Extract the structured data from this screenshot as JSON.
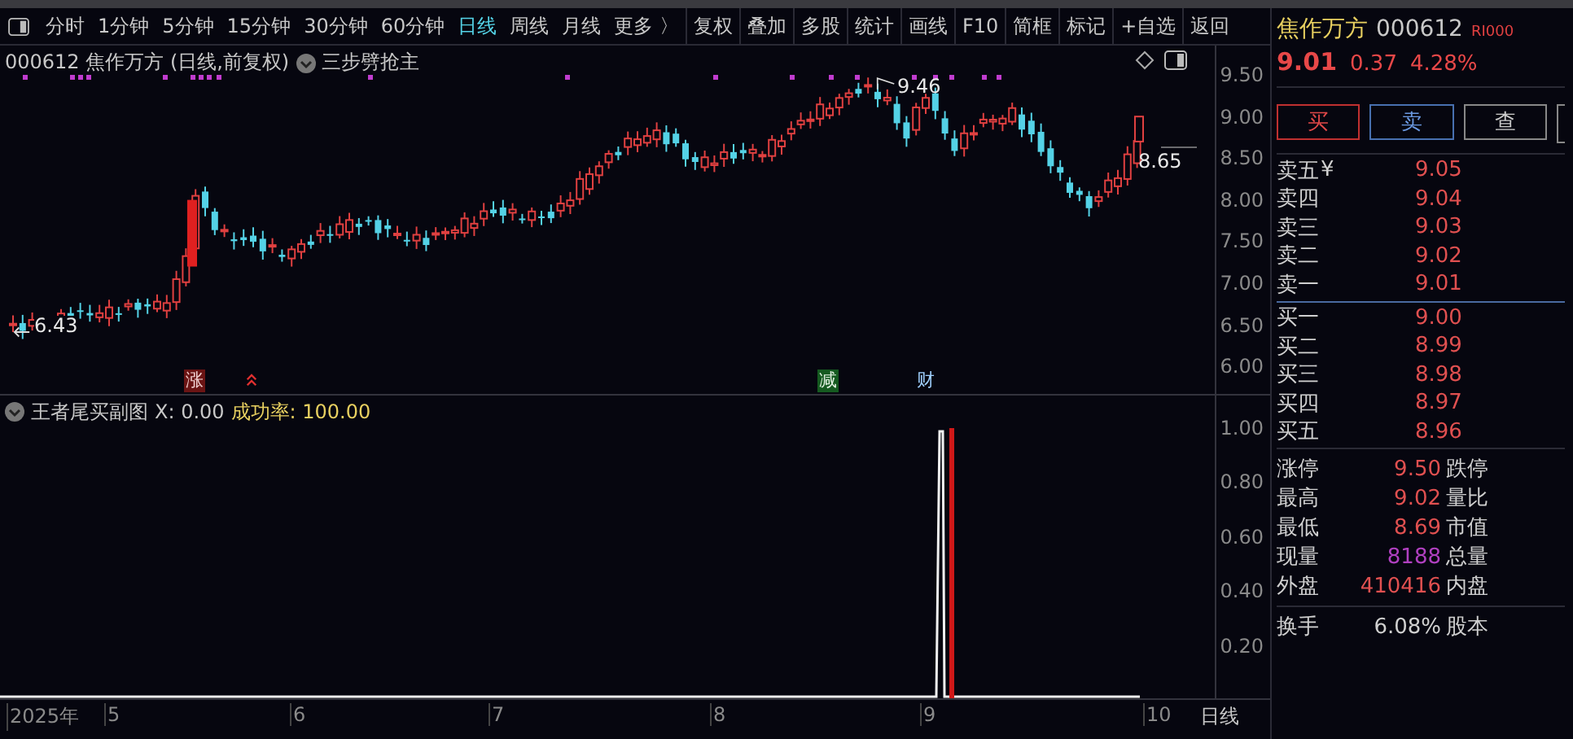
{
  "toolbar": {
    "periods": [
      {
        "label": "分时",
        "selected": false
      },
      {
        "label": "1分钟",
        "selected": false
      },
      {
        "label": "5分钟",
        "selected": false
      },
      {
        "label": "15分钟",
        "selected": false
      },
      {
        "label": "30分钟",
        "selected": false
      },
      {
        "label": "60分钟",
        "selected": false
      },
      {
        "label": "日线",
        "selected": true
      },
      {
        "label": "周线",
        "selected": false
      },
      {
        "label": "月线",
        "selected": false
      },
      {
        "label": "更多 〉",
        "selected": false
      }
    ],
    "tools": [
      "复权",
      "叠加",
      "多股",
      "统计",
      "画线",
      "F10",
      "简框",
      "标记",
      "+自选",
      "返回"
    ]
  },
  "main_chart": {
    "title": "000612 焦作万方 (日线,前复权)",
    "indicator": "三步劈抢主",
    "y_ticks": [
      "9.50",
      "9.00",
      "8.50",
      "8.00",
      "7.50",
      "7.00",
      "6.50",
      "6.00"
    ],
    "high_label": "9.46",
    "last_label": "8.65",
    "low_label": "6.43",
    "markers": [
      {
        "text": "涨",
        "kind": "rise"
      },
      {
        "text": "减",
        "kind": "cut"
      },
      {
        "text": "财",
        "kind": "finance"
      }
    ]
  },
  "sub_chart": {
    "name": "王者尾买副图",
    "x_value": "X: 0.00",
    "rate": "成功率: 100.00",
    "y_ticks": [
      "1.00",
      "0.80",
      "0.60",
      "0.40",
      "0.20"
    ]
  },
  "x_axis": {
    "labels": [
      "2025年",
      "5",
      "6",
      "7",
      "8",
      "9",
      "10"
    ],
    "period": "日线"
  },
  "quote": {
    "name": "焦作万方",
    "code": "000612",
    "badge": "RI000",
    "price": "9.01",
    "change": "0.37",
    "percent": "4.28%",
    "buttons": [
      {
        "label": "买",
        "kind": "buy"
      },
      {
        "label": "卖",
        "kind": "sell"
      },
      {
        "label": "查",
        "kind": "query"
      }
    ],
    "asks": [
      {
        "label": "卖五",
        "mark": "¥",
        "price": "9.05"
      },
      {
        "label": "卖四",
        "price": "9.04"
      },
      {
        "label": "卖三",
        "price": "9.03"
      },
      {
        "label": "卖二",
        "price": "9.02"
      },
      {
        "label": "卖一",
        "price": "9.01"
      }
    ],
    "bids": [
      {
        "label": "买一",
        "price": "9.00"
      },
      {
        "label": "买二",
        "price": "8.99"
      },
      {
        "label": "买三",
        "price": "8.98"
      },
      {
        "label": "买四",
        "price": "8.97"
      },
      {
        "label": "买五",
        "price": "8.96"
      }
    ],
    "stats": [
      {
        "label": "涨停",
        "value": "9.50",
        "label2": "跌停",
        "kind": "rise"
      },
      {
        "label": "最高",
        "value": "9.02",
        "label2": "量比",
        "kind": "rise"
      },
      {
        "label": "最低",
        "value": "8.69",
        "label2": "市值",
        "kind": "rise"
      },
      {
        "label": "现量",
        "value": "8188",
        "label2": "总量",
        "kind": "volume"
      },
      {
        "label": "外盘",
        "value": "410416",
        "label2": "内盘",
        "kind": "rise"
      }
    ],
    "turnover": {
      "label": "换手",
      "value": "6.08%",
      "label2": "股本",
      "kind": "neutral"
    }
  }
}
